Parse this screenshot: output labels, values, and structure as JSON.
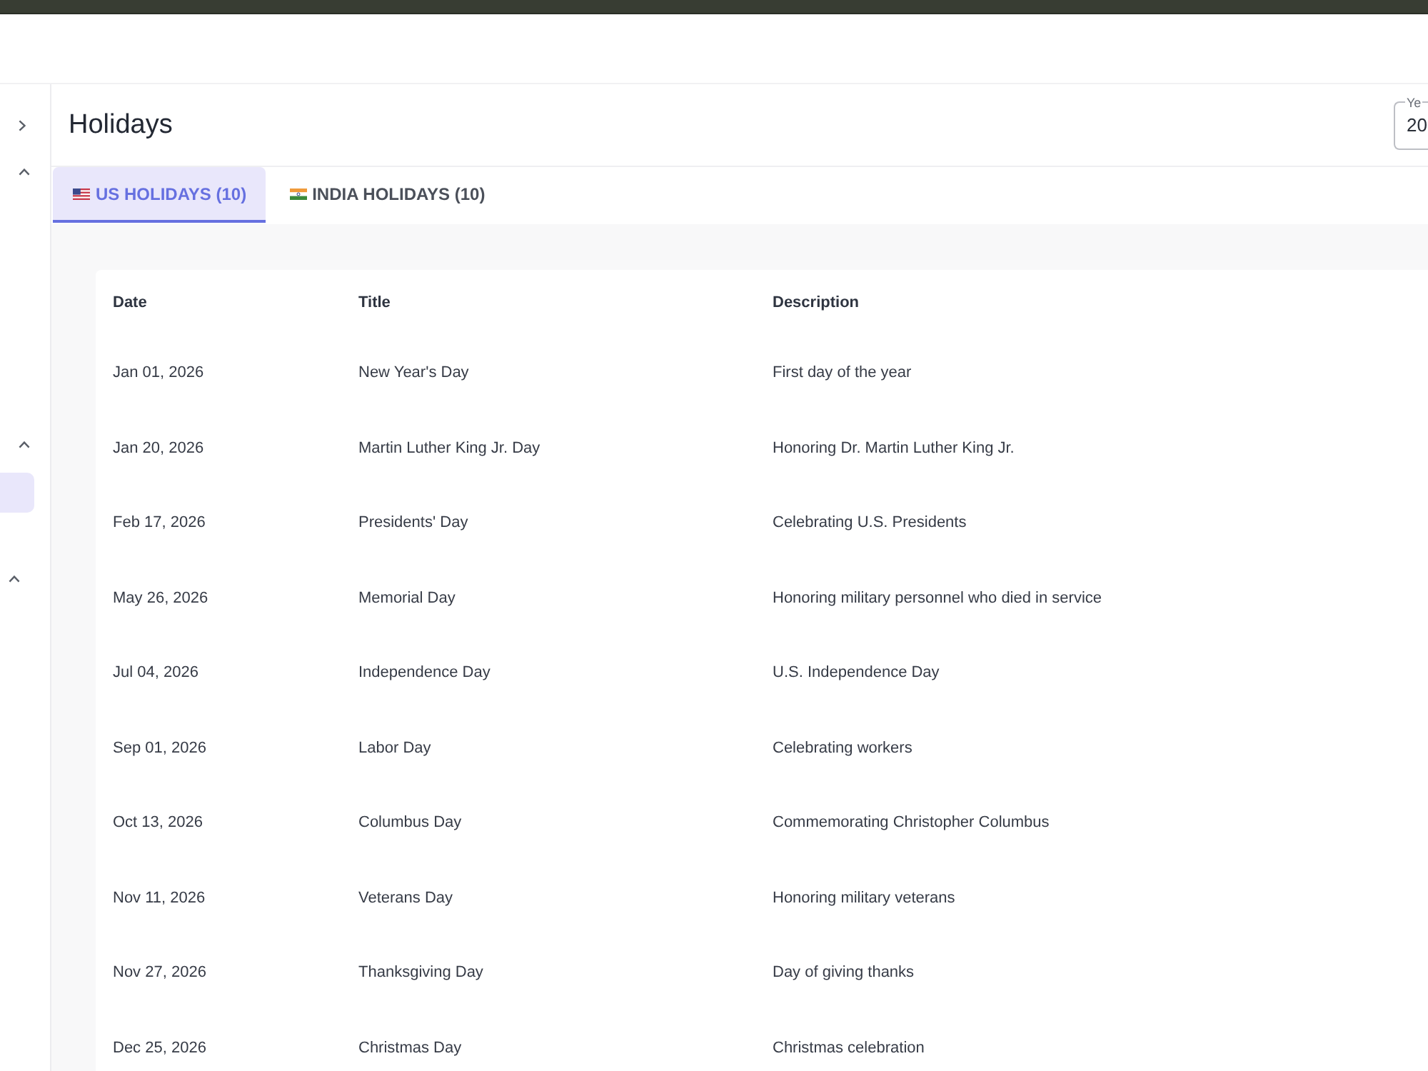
{
  "sidebar": {
    "items": [
      {
        "kind": "toggle"
      },
      {
        "kind": "group",
        "expanded": true
      },
      {
        "kind": "group",
        "expanded": true
      },
      {
        "kind": "link",
        "selected": true
      },
      {
        "kind": "subgroup",
        "expanded": true
      }
    ]
  },
  "page": {
    "title": "Holidays"
  },
  "year_field": {
    "label": "Ye",
    "value": "20"
  },
  "tabs": [
    {
      "kind": "us",
      "label": "US HOLIDAYS (10)",
      "selected": true
    },
    {
      "kind": "india",
      "label": "INDIA HOLIDAYS (10)",
      "selected": false
    }
  ],
  "table": {
    "columns": [
      "Date",
      "Title",
      "Description"
    ],
    "rows": [
      [
        "Jan 01, 2026",
        "New Year's Day",
        "First day of the year"
      ],
      [
        "Jan 20, 2026",
        "Martin Luther King Jr. Day",
        "Honoring Dr. Martin Luther King Jr."
      ],
      [
        "Feb 17, 2026",
        "Presidents' Day",
        "Celebrating U.S. Presidents"
      ],
      [
        "May 26, 2026",
        "Memorial Day",
        "Honoring military personnel who died in service"
      ],
      [
        "Jul 04, 2026",
        "Independence Day",
        "U.S. Independence Day"
      ],
      [
        "Sep 01, 2026",
        "Labor Day",
        "Celebrating workers"
      ],
      [
        "Oct 13, 2026",
        "Columbus Day",
        "Commemorating Christopher Columbus"
      ],
      [
        "Nov 11, 2026",
        "Veterans Day",
        "Honoring military veterans"
      ],
      [
        "Nov 27, 2026",
        "Thanksgiving Day",
        "Day of giving thanks"
      ],
      [
        "Dec 25, 2026",
        "Christmas Day",
        "Christmas celebration"
      ]
    ]
  }
}
